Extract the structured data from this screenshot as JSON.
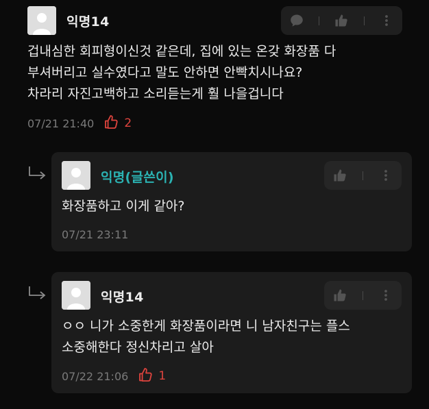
{
  "comments": [
    {
      "author": "익명14",
      "author_is_writer": false,
      "lines": [
        "겁내심한 회피형이신것 같은데, 집에 있는 온갖 화장품 다",
        "부셔버리고 실수였다고 말도 안하면 안빡치시나요?",
        "차라리 자진고백하고 소리듣는게 훨 나을겁니다"
      ],
      "timestamp": "07/21 21:40",
      "likes": "2"
    }
  ],
  "replies": [
    {
      "author": "익명(글쓴이)",
      "author_is_writer": true,
      "lines": [
        "화장품하고 이게 같아?"
      ],
      "timestamp": "07/21 23:11",
      "likes": ""
    },
    {
      "author": "익명14",
      "author_is_writer": false,
      "lines": [
        "ㅇㅇ 니가 소중한게 화장품이라면 니 남자친구는 플스",
        "소중해한다 정신차리고 살아"
      ],
      "timestamp": "07/22 21:06",
      "likes": "1"
    }
  ],
  "icons": {
    "reply": "speech-bubble-icon",
    "like": "thumbs-up-icon",
    "more": "more-vertical-icon",
    "avatar": "default-avatar-icon",
    "reply_arrow": "reply-arrow-icon",
    "like_outline": "thumbs-up-outline-icon"
  },
  "colors": {
    "background": "#0b0b0b",
    "card": "#1c1c1c",
    "writer_name": "#2bb3b3",
    "like_count": "#e0443e",
    "meta": "#7a7a7a"
  }
}
